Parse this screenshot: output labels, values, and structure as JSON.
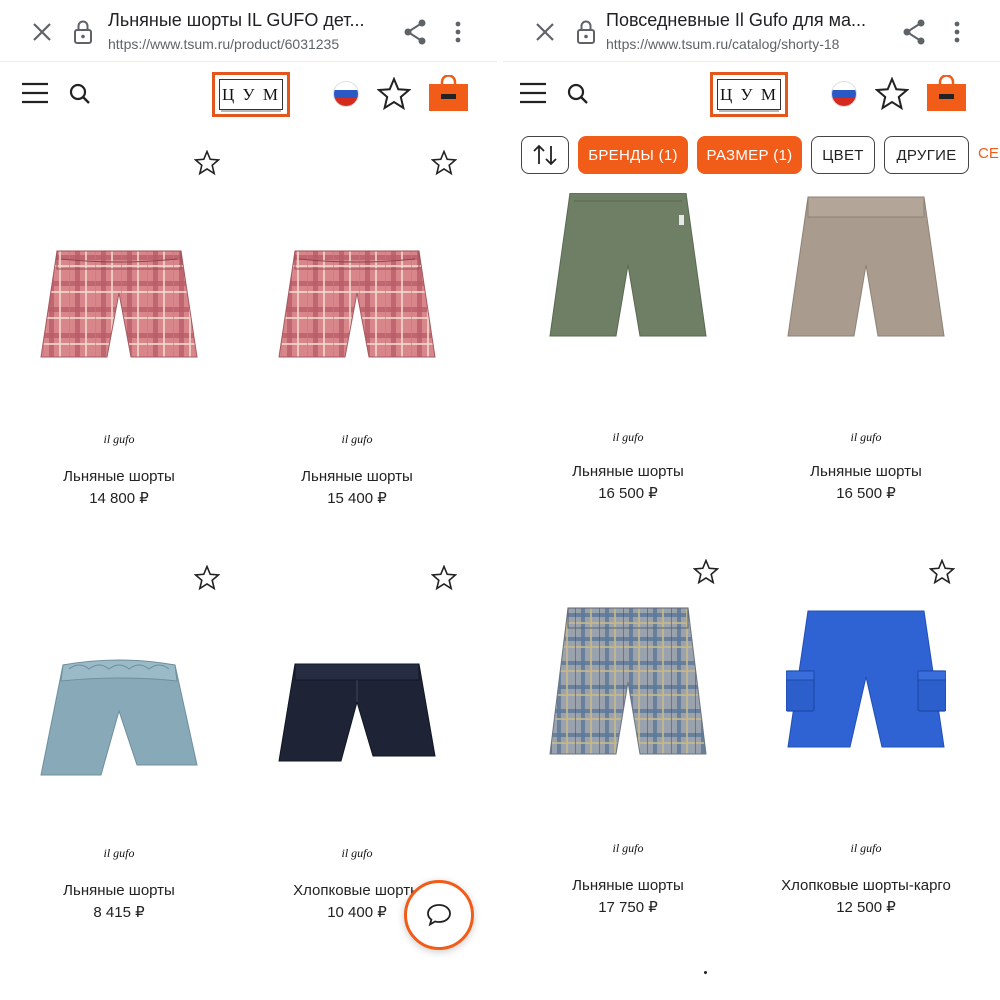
{
  "colors": {
    "accent": "#f25c19",
    "logo_border": "#e3571d"
  },
  "left": {
    "browser": {
      "title": "Льняные шорты IL GUFO дет...",
      "url": "https://www.tsum.ru/product/6031235"
    },
    "logo": {
      "text": "Ц У М"
    },
    "products": [
      {
        "brand": "il gufo",
        "name": "Льняные шорты",
        "price": "14 800 ₽",
        "image": "pink-plaid-shorts"
      },
      {
        "brand": "il gufo",
        "name": "Льняные шорты",
        "price": "15 400 ₽",
        "image": "pink-plaid-shorts"
      },
      {
        "brand": "il gufo",
        "name": "Льняные шорты",
        "price": "8 415 ₽",
        "image": "light-blue-shorts"
      },
      {
        "brand": "il gufo",
        "name": "Хлопковые шорты",
        "price": "10 400 ₽",
        "image": "navy-shorts"
      }
    ]
  },
  "right": {
    "browser": {
      "title": "Повседневные Il Gufo для ма...",
      "url": "https://www.tsum.ru/catalog/shorty-18"
    },
    "logo": {
      "text": "Ц У М"
    },
    "filters": {
      "sort_icon": "sort-arrows-icon",
      "brands": "БРЕНДЫ (1)",
      "size": "РАЗМЕР (1)",
      "color": "ЦВЕТ",
      "other": "ДРУГИЕ",
      "more": "СЕ"
    },
    "products": [
      {
        "brand": "il gufo",
        "name": "Льняные шорты",
        "price": "16 500 ₽",
        "image": "green-shorts"
      },
      {
        "brand": "il gufo",
        "name": "Льняные шорты",
        "price": "16 500 ₽",
        "image": "beige-shorts"
      },
      {
        "brand": "il gufo",
        "name": "Льняные шорты",
        "price": "17 750 ₽",
        "image": "grey-plaid-shorts"
      },
      {
        "brand": "il gufo",
        "name": "Хлопковые шорты-карго",
        "price": "12 500 ₽",
        "image": "blue-cargo-shorts"
      }
    ]
  }
}
